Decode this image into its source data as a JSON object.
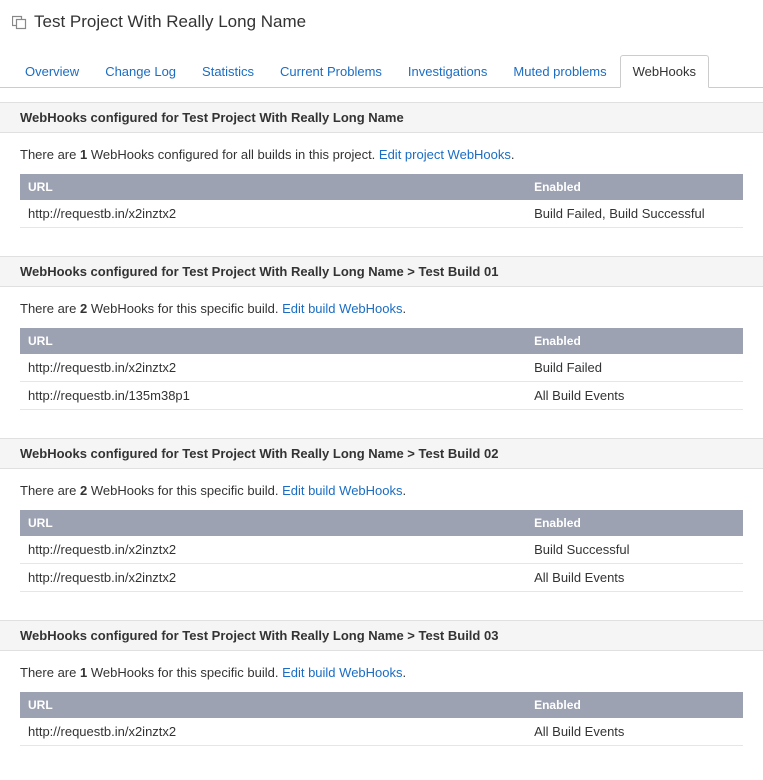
{
  "page": {
    "title": "Test Project With Really Long Name"
  },
  "tabs": [
    {
      "label": "Overview"
    },
    {
      "label": "Change Log"
    },
    {
      "label": "Statistics"
    },
    {
      "label": "Current Problems"
    },
    {
      "label": "Investigations"
    },
    {
      "label": "Muted problems"
    },
    {
      "label": "WebHooks"
    }
  ],
  "sections": [
    {
      "header": "WebHooks configured for Test Project With Really Long Name",
      "summary_prefix": "There are ",
      "summary_count": "1",
      "summary_suffix": " WebHooks configured for all builds in this project. ",
      "edit_label": "Edit project WebHooks",
      "period": ".",
      "col_url": "URL",
      "col_enabled": "Enabled",
      "rows": [
        {
          "url": "http://requestb.in/x2inztx2",
          "enabled": "Build Failed, Build Successful"
        }
      ]
    },
    {
      "header": "WebHooks configured for Test Project With Really Long Name > Test Build 01",
      "summary_prefix": "There are ",
      "summary_count": "2",
      "summary_suffix": " WebHooks for this specific build. ",
      "edit_label": "Edit build WebHooks",
      "period": ".",
      "col_url": "URL",
      "col_enabled": "Enabled",
      "rows": [
        {
          "url": "http://requestb.in/x2inztx2",
          "enabled": "Build Failed"
        },
        {
          "url": "http://requestb.in/135m38p1",
          "enabled": "All Build Events"
        }
      ]
    },
    {
      "header": "WebHooks configured for Test Project With Really Long Name > Test Build 02",
      "summary_prefix": "There are ",
      "summary_count": "2",
      "summary_suffix": " WebHooks for this specific build. ",
      "edit_label": "Edit build WebHooks",
      "period": ".",
      "col_url": "URL",
      "col_enabled": "Enabled",
      "rows": [
        {
          "url": "http://requestb.in/x2inztx2",
          "enabled": "Build Successful"
        },
        {
          "url": "http://requestb.in/x2inztx2",
          "enabled": "All Build Events"
        }
      ]
    },
    {
      "header": "WebHooks configured for Test Project With Really Long Name > Test Build 03",
      "summary_prefix": "There are ",
      "summary_count": "1",
      "summary_suffix": " WebHooks for this specific build. ",
      "edit_label": "Edit build WebHooks",
      "period": ".",
      "col_url": "URL",
      "col_enabled": "Enabled",
      "rows": [
        {
          "url": "http://requestb.in/x2inztx2",
          "enabled": "All Build Events"
        }
      ]
    }
  ]
}
